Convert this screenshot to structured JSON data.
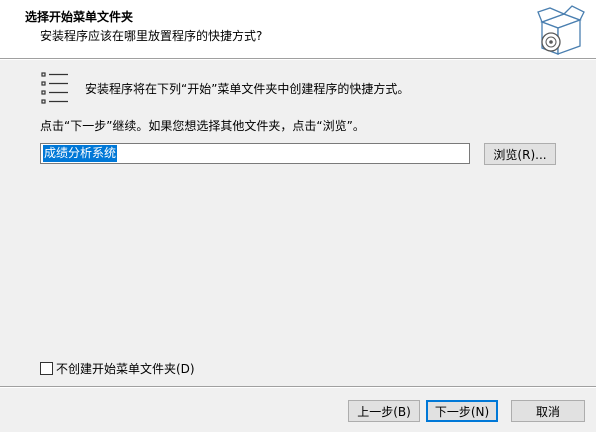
{
  "header": {
    "title": "选择开始菜单文件夹",
    "subtitle": "安装程序应该在哪里放置程序的快捷方式?"
  },
  "body": {
    "info_text": "安装程序将在下列“开始”菜单文件夹中创建程序的快捷方式。",
    "instruction_text": "点击“下一步”继续。如果您想选择其他文件夹，点击“浏览”。",
    "folder_value": "成绩分析系统",
    "browse_label": "浏览(R)...",
    "no_folder_checkbox": {
      "label": "不创建开始菜单文件夹(D)",
      "checked": false
    }
  },
  "footer": {
    "back_label": "上一步(B)",
    "next_label": "下一步(N)",
    "cancel_label": "取消"
  },
  "colors": {
    "window_bg": "#f0f0f0",
    "header_bg": "#ffffff",
    "selection": "#0078d7",
    "button_face": "#e1e1e1",
    "default_button_border": "#0078d7"
  },
  "icons": {
    "header_graphic": "software-box-disc-icon",
    "folder_list": "list-icon"
  }
}
